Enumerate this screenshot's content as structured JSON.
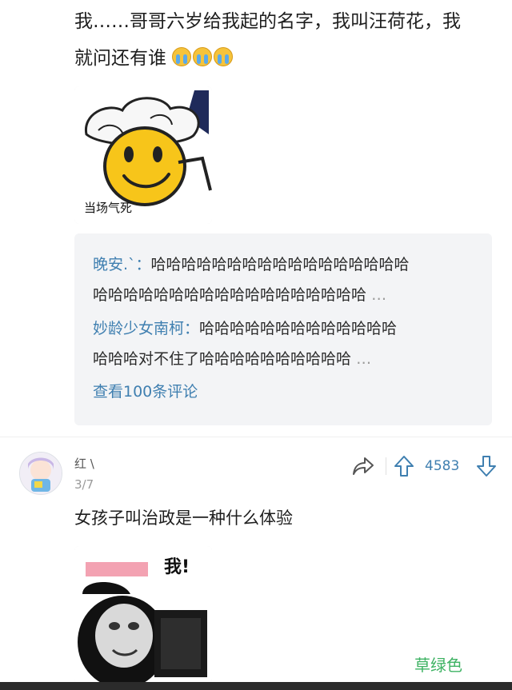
{
  "post": {
    "line1": "我……哥哥六岁给我起的名字，我叫汪荷花，我",
    "line2": "就问还有谁",
    "emoji_name": "crying-face-icon"
  },
  "sticker1": {
    "caption": "当场气死"
  },
  "replies": {
    "items": [
      {
        "user": "晚安.`：",
        "text1": "哈哈哈哈哈哈哈哈哈哈哈哈哈哈哈哈哈",
        "text2": "哈哈哈哈哈哈哈哈哈哈哈哈哈哈哈哈哈哈",
        "ellipsis": "…"
      },
      {
        "user": "妙龄少女南柯：",
        "text1": "哈哈哈哈哈哈哈哈哈哈哈哈哈",
        "text2": "哈哈哈对不住了哈哈哈哈哈哈哈哈哈哈",
        "ellipsis": "…"
      }
    ],
    "more": "查看100条评论"
  },
  "comment": {
    "username": "红 \\",
    "date": "3/7",
    "text": "女孩子叫治政是一种什么体验",
    "upvotes": "4583",
    "sticker_text": "我!"
  },
  "watermark": "草绿色",
  "colors": {
    "link": "#3f7fb0",
    "panel": "#f3f4f6",
    "watermark": "#3fb364"
  }
}
